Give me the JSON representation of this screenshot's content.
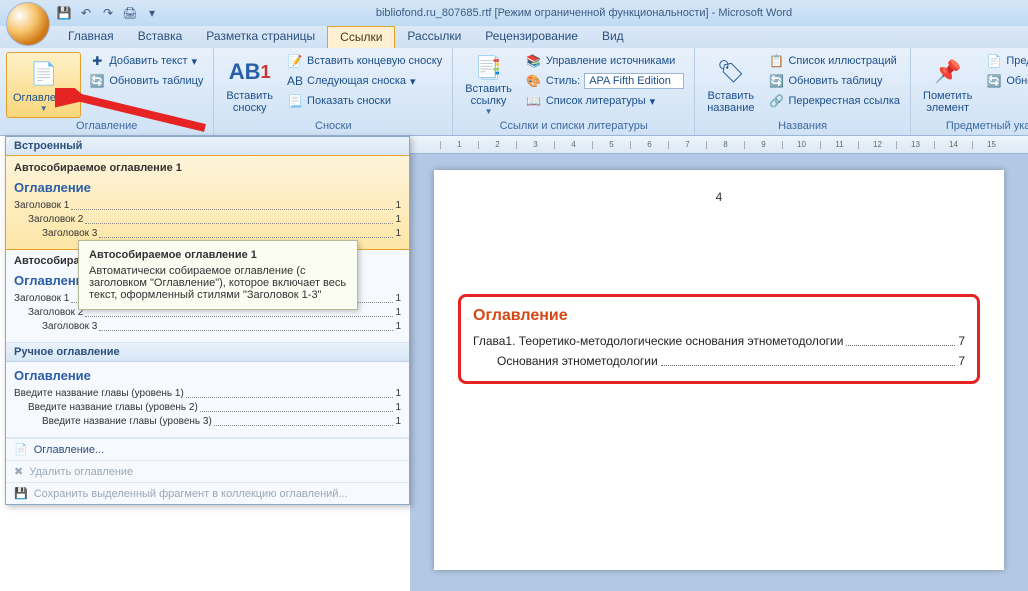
{
  "window": {
    "title": "bibliofond.ru_807685.rtf [Режим ограниченной функциональности] - Microsoft Word"
  },
  "tabs": {
    "home": "Главная",
    "insert": "Вставка",
    "layout": "Разметка страницы",
    "references": "Ссылки",
    "mailings": "Рассылки",
    "review": "Рецензирование",
    "view": "Вид"
  },
  "ribbon": {
    "toc": {
      "button": "Оглавление",
      "add_text": "Добавить текст",
      "update": "Обновить таблицу",
      "group": "Оглавление"
    },
    "footnote": {
      "big": "Вставить сноску",
      "endnote": "Вставить концевую сноску",
      "next": "Следующая сноска",
      "show": "Показать сноски",
      "group": "Сноски"
    },
    "citation": {
      "big": "Вставить ссылку",
      "manage": "Управление источниками",
      "style_label": "Стиль:",
      "style_value": "APA Fifth Edition",
      "biblio": "Список литературы",
      "group": "Ссылки и списки литературы"
    },
    "caption": {
      "big": "Вставить название",
      "figures": "Список иллюстраций",
      "update": "Обновить таблицу",
      "crossref": "Перекрестная ссылка",
      "group": "Названия"
    },
    "index": {
      "big": "Пометить элемент",
      "item1": "Предметный",
      "item2": "Обновить",
      "group": "Предметный указат"
    }
  },
  "gallery": {
    "builtin_header": "Встроенный",
    "auto1_title": "Автособираемое оглавление 1",
    "auto2_title": "Автособираемое оглавление 2",
    "manual_title": "Ручное оглавление",
    "toc_heading": "Оглавление",
    "h1": "Заголовок 1",
    "h2": "Заголовок 2",
    "h3": "Заголовок 3",
    "m1": "Введите название главы (уровень 1)",
    "m2": "Введите название главы (уровень 2)",
    "m3": "Введите название главы (уровень 3)",
    "page1": "1",
    "footer_insert": "Оглавление...",
    "footer_remove": "Удалить оглавление",
    "footer_save": "Сохранить выделенный фрагмент в коллекцию оглавлений..."
  },
  "tooltip": {
    "title": "Автособираемое оглавление 1",
    "body": "Автоматически собираемое оглавление (с заголовком \"Оглавление\"), которое включает весь текст, оформленный стилями \"Заголовок 1-3\""
  },
  "ruler": {
    "ticks": [
      "1",
      "2",
      "3",
      "4",
      "5",
      "6",
      "7",
      "8",
      "9",
      "10",
      "11",
      "12",
      "13",
      "14",
      "15"
    ]
  },
  "document": {
    "page_number": "4",
    "toc_title": "Оглавление",
    "line1": "Глава1. Теоретико-методологические основания этнометодологии",
    "line1_page": "7",
    "line2": "Основания этнометодологии",
    "line2_page": "7"
  }
}
